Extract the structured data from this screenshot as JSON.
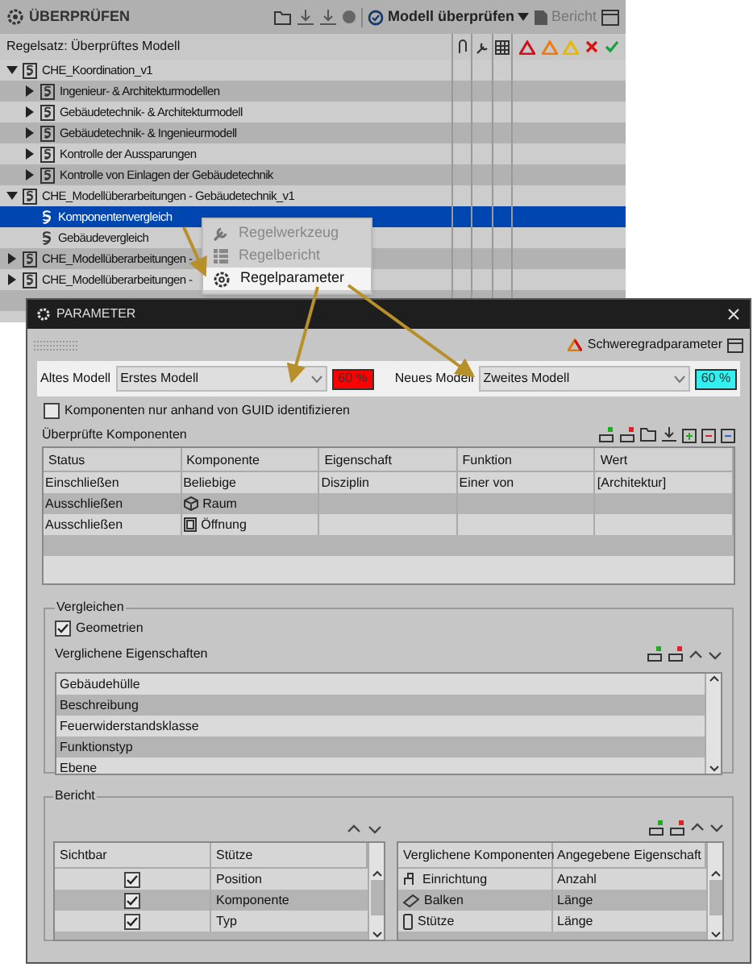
{
  "panel": {
    "title": "ÜBERPRÜFEN",
    "check_button": "Modell überprüfen",
    "report_button": "Bericht",
    "ruleset_label": "Regelsatz: Überprüftes Modell"
  },
  "tree": [
    {
      "label": "CHE_Koordination_v1",
      "kind": "ruleset",
      "expanded": true,
      "selected": false,
      "children": [
        {
          "label": "Ingenieur- & Architekturmodellen",
          "kind": "ruleset",
          "expanded": false,
          "selected": false
        },
        {
          "label": "Gebäudetechnik- & Architekturmodell",
          "kind": "ruleset",
          "expanded": false,
          "selected": false
        },
        {
          "label": "Gebäudetechnik- & Ingenieurmodell",
          "kind": "ruleset",
          "expanded": false,
          "selected": false
        },
        {
          "label": "Kontrolle der Aussparungen",
          "kind": "ruleset",
          "expanded": false,
          "selected": false
        },
        {
          "label": "Kontrolle von Einlagen der Gebäudetechnik",
          "kind": "ruleset",
          "expanded": false,
          "selected": false
        }
      ]
    },
    {
      "label": "CHE_Modellüberarbeitungen - Gebäudetechnik_v1",
      "kind": "ruleset",
      "expanded": true,
      "selected": false,
      "children": [
        {
          "label": "Komponentenvergleich",
          "kind": "rule",
          "selected": true
        },
        {
          "label": "Gebäudevergleich",
          "kind": "rule",
          "selected": false
        }
      ]
    },
    {
      "label": "CHE_Modellüberarbeitungen -",
      "kind": "ruleset",
      "expanded": false,
      "selected": false
    },
    {
      "label": "CHE_Modellüberarbeitungen -",
      "kind": "ruleset",
      "expanded": false,
      "selected": false
    }
  ],
  "context_menu": [
    {
      "label": "Regelwerkzeug",
      "kind": "tool",
      "disabled": true,
      "selected": false
    },
    {
      "label": "Regelbericht",
      "kind": "report",
      "disabled": true,
      "selected": false
    },
    {
      "label": "Regelparameter",
      "kind": "settings",
      "disabled": false,
      "selected": true
    }
  ],
  "dialog": {
    "title": "PARAMETER",
    "severity_button": "Schweregradparameter",
    "models": [
      {
        "label": "Altes Modell",
        "value": "Erstes Modell",
        "badge": "60 %",
        "color": "#ff0000"
      },
      {
        "label": "Neues Modell",
        "value": "Zweites Modell",
        "badge": "60 %",
        "color": "#33f0f0"
      }
    ],
    "guid_checkbox": {
      "label": "Komponenten nur anhand von GUID identifizieren",
      "checked": false
    },
    "components_label": "Überprüfte Komponenten",
    "components": {
      "columns": [
        "Status",
        "Komponente",
        "Eigenschaft",
        "Funktion",
        "Wert"
      ],
      "rows": [
        {
          "kind": "any",
          "cells": [
            "Einschließen",
            "Beliebige",
            "Disziplin",
            "Einer von",
            "[Architektur]"
          ]
        },
        {
          "kind": "room",
          "cells": [
            "Ausschließen",
            "Raum",
            "",
            "",
            ""
          ]
        },
        {
          "kind": "opening",
          "cells": [
            "Ausschließen",
            "Öffnung",
            "",
            "",
            ""
          ]
        }
      ]
    },
    "compare": {
      "title": "Vergleichen",
      "geometry": {
        "label": "Geometrien",
        "checked": true
      },
      "properties_label": "Verglichene Eigenschaften",
      "properties": [
        "Gebäudehülle",
        "Beschreibung",
        "Feuerwiderstandsklasse",
        "Funktionstyp",
        "Ebene"
      ]
    },
    "report": {
      "title": "Bericht",
      "visibility": {
        "columns": [
          "Sichtbar",
          "Stütze"
        ],
        "rows": [
          {
            "visible": true,
            "label": "Position"
          },
          {
            "visible": true,
            "label": "Komponente"
          },
          {
            "visible": true,
            "label": "Typ"
          }
        ]
      },
      "compared": {
        "columns": [
          "Verglichene Komponenten",
          "Angegebene Eigenschaft"
        ],
        "rows": [
          {
            "kind": "furniture",
            "component": "Einrichtung",
            "property": "Anzahl"
          },
          {
            "kind": "beam",
            "component": "Balken",
            "property": "Länge"
          },
          {
            "kind": "column",
            "component": "Stütze",
            "property": "Länge"
          }
        ]
      }
    }
  }
}
